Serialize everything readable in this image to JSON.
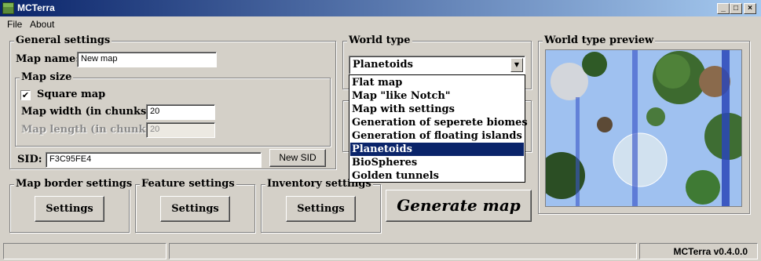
{
  "window": {
    "title": "MCTerra",
    "min_label": "_",
    "max_label": "□",
    "close_label": "×"
  },
  "menu": [
    {
      "label": "File"
    },
    {
      "label": "About"
    }
  ],
  "general": {
    "legend": "General settings",
    "map_name_label": "Map name:",
    "map_name_value": "New map",
    "map_size_legend": "Map size",
    "square_map_label": "Square map",
    "square_map_checked": "✔",
    "width_label": "Map width (in chunks)",
    "width_value": "20",
    "length_label": "Map length (in chunks)",
    "length_value": "20",
    "sid_label": "SID:",
    "sid_value": "F3C95FE4",
    "new_sid_button": "New SID"
  },
  "settings_groups": {
    "map_border": {
      "legend": "Map border settings",
      "button": "Settings"
    },
    "feature": {
      "legend": "Feature settings",
      "button": "Settings"
    },
    "inventory": {
      "legend": "Inventory settings",
      "button": "Settings"
    }
  },
  "world_type": {
    "legend": "World type",
    "selected": "Planetoids",
    "options": [
      "Flat map",
      "Map \"like Notch\"",
      "Map with settings",
      "Generation of seperete biomes",
      "Generation of floating islands",
      "Planetoids",
      "BioSpheres",
      "Golden tunnels"
    ]
  },
  "generate_button": "Generate map",
  "preview": {
    "legend": "World type preview"
  },
  "status": {
    "version": "MCTerra v0.4.0.0"
  },
  "colors": {
    "title_start": "#0a246a",
    "title_end": "#a6caf0",
    "selection": "#0a246a",
    "face": "#d4d0c8"
  },
  "icons": {
    "app": "grass-block-icon",
    "dropdown": "chevron-down-icon",
    "check": "checkmark-icon"
  }
}
